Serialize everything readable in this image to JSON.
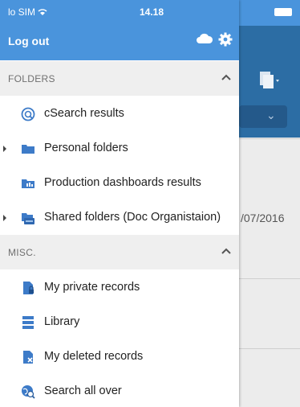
{
  "status_bar": {
    "carrier": "lo SIM",
    "time": "14.18"
  },
  "drawer": {
    "logout_label": "Log out",
    "sections": [
      {
        "label": "FOLDERS",
        "items": [
          {
            "label": "cSearch results",
            "icon": "search-icon"
          },
          {
            "label": "Personal folders",
            "icon": "folder-icon",
            "expandable": true
          },
          {
            "label": "Production dashboards results",
            "icon": "dashboard-folder-icon"
          },
          {
            "label": "Shared folders (Doc Organistaion)",
            "icon": "shared-folder-icon",
            "expandable": true
          }
        ]
      },
      {
        "label": "MISC.",
        "items": [
          {
            "label": "My private records",
            "icon": "private-record-icon"
          },
          {
            "label": "Library",
            "icon": "library-icon"
          },
          {
            "label": "My deleted records",
            "icon": "deleted-record-icon"
          },
          {
            "label": "Search all over",
            "icon": "globe-search-icon"
          }
        ]
      }
    ]
  },
  "background": {
    "date_text": "/07/2016"
  },
  "colors": {
    "header": "#4a94dc",
    "dark_header": "#2c6da4",
    "icon_blue": "#3d7bc8"
  }
}
